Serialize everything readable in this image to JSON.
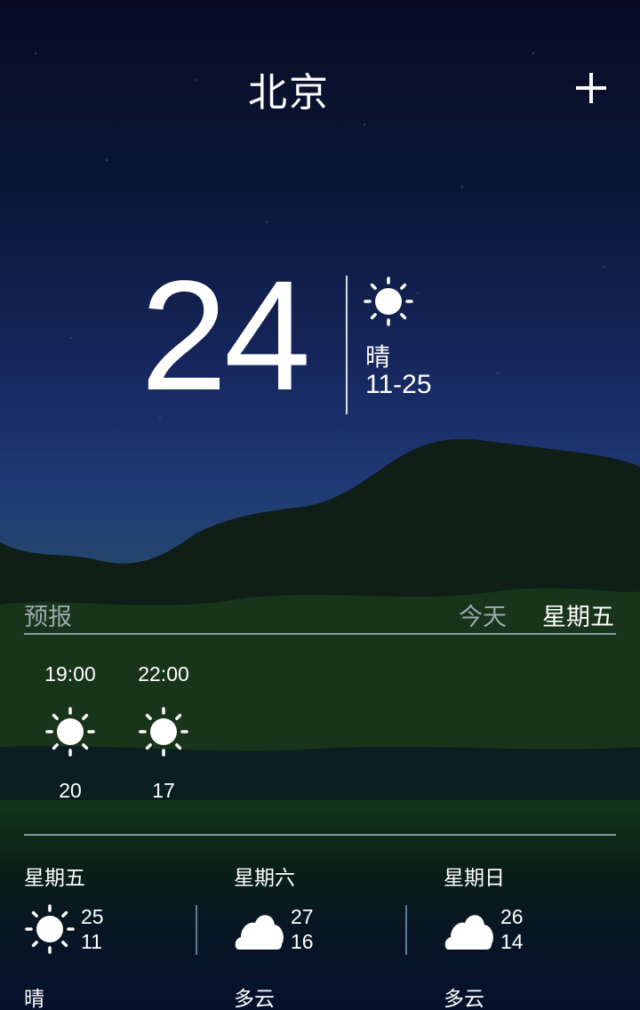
{
  "header": {
    "city": "北京",
    "add_icon": "plus-icon"
  },
  "current": {
    "temperature": "24",
    "condition": "晴",
    "range": "11-25",
    "icon": "sun-icon"
  },
  "forecast": {
    "label": "预报",
    "tabs": [
      {
        "label": "今天",
        "selected": false
      },
      {
        "label": "星期五",
        "selected": true
      }
    ]
  },
  "hourly": [
    {
      "time": "19:00",
      "temp": "20",
      "icon": "sun-icon"
    },
    {
      "time": "22:00",
      "temp": "17",
      "icon": "sun-icon"
    }
  ],
  "daily": [
    {
      "day": "星期五",
      "high": "25",
      "low": "11",
      "condition": "晴",
      "icon": "sun-icon"
    },
    {
      "day": "星期六",
      "high": "27",
      "low": "16",
      "condition": "多云",
      "icon": "cloud-icon"
    },
    {
      "day": "星期日",
      "high": "26",
      "low": "14",
      "condition": "多云",
      "icon": "cloud-icon"
    }
  ],
  "colors": {
    "divider": "#b4cde1",
    "muted_text": "#c8d2e1",
    "text": "#ffffff"
  }
}
